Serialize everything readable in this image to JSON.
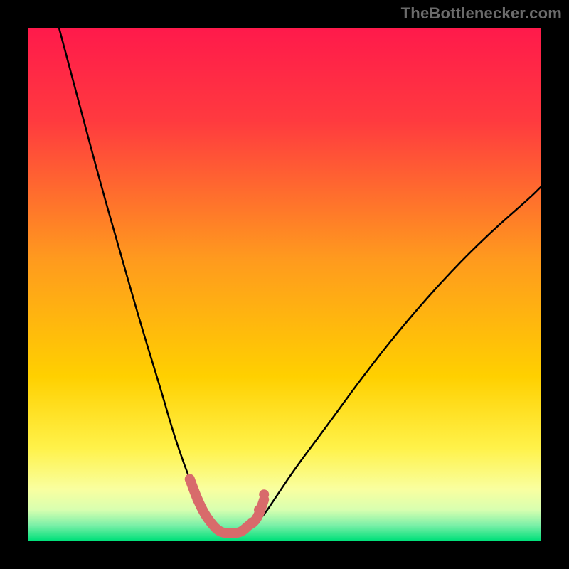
{
  "watermark": {
    "text": "TheBottlenecker.com"
  },
  "chart_data": {
    "type": "line",
    "title": "",
    "xlabel": "",
    "ylabel": "",
    "xlim": [
      0,
      100
    ],
    "ylim": [
      0,
      100
    ],
    "background": {
      "gradient_top": "#ff1a4b",
      "gradient_mid": "#ffd000",
      "gradient_low": "#f9ffa0",
      "gradient_bottom": "#00e07a"
    },
    "series": [
      {
        "name": "left-curve",
        "type": "line",
        "stroke": "#000000",
        "x": [
          6,
          10,
          14,
          18,
          22,
          26,
          28,
          30,
          31.5,
          33,
          34.5,
          36,
          37.5
        ],
        "y": [
          100,
          85,
          70,
          56,
          42,
          29,
          22,
          16,
          12,
          8,
          5,
          3,
          2
        ]
      },
      {
        "name": "right-curve",
        "type": "line",
        "stroke": "#000000",
        "x": [
          42,
          44,
          46,
          48,
          52,
          58,
          66,
          74,
          82,
          90,
          98,
          100
        ],
        "y": [
          2,
          3,
          5,
          8,
          14,
          22,
          33,
          43,
          52,
          60,
          67,
          69
        ]
      },
      {
        "name": "bottleneck-region",
        "type": "line",
        "stroke": "#d86b6b",
        "stroke_width": 7,
        "x": [
          31.5,
          33,
          34.5,
          36,
          37,
          38,
          39,
          40,
          41,
          42,
          43,
          44,
          45,
          46
        ],
        "y": [
          12,
          8,
          5,
          3,
          2,
          1.5,
          1.5,
          1.5,
          1.5,
          2,
          3,
          3.5,
          5,
          8
        ]
      }
    ],
    "markers": [
      {
        "x": 31.5,
        "y": 12,
        "r": 7,
        "fill": "#d86b6b"
      },
      {
        "x": 33.0,
        "y": 8,
        "r": 7,
        "fill": "#d86b6b"
      },
      {
        "x": 43.5,
        "y": 3.5,
        "r": 7,
        "fill": "#d86b6b"
      },
      {
        "x": 45.0,
        "y": 6,
        "r": 7,
        "fill": "#d86b6b"
      },
      {
        "x": 46.0,
        "y": 9,
        "r": 7,
        "fill": "#d86b6b"
      }
    ]
  }
}
